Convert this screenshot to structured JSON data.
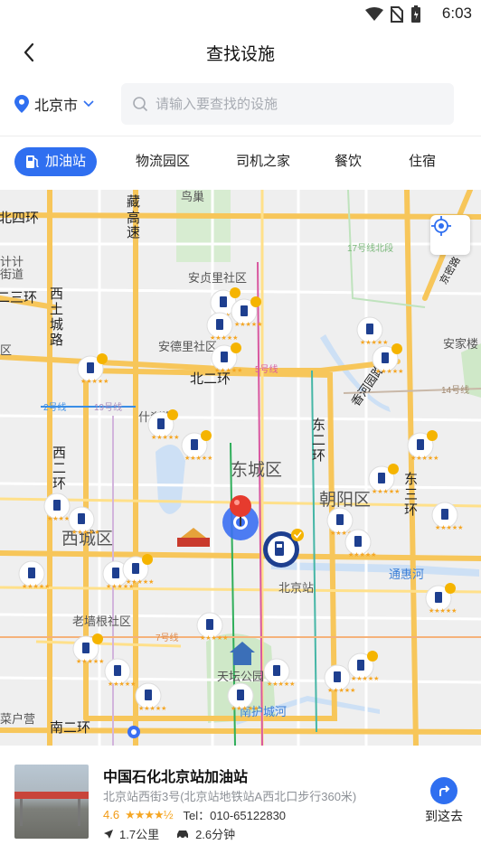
{
  "status_bar": {
    "time": "6:03"
  },
  "header": {
    "title": "查找设施",
    "back_icon": "chevron-left-icon"
  },
  "search": {
    "city": "北京市",
    "placeholder": "请输入要查找的设施"
  },
  "tabs": [
    {
      "label": "加油站",
      "active": true
    },
    {
      "label": "物流园区",
      "active": false
    },
    {
      "label": "司机之家",
      "active": false
    },
    {
      "label": "餐饮",
      "active": false
    },
    {
      "label": "住宿",
      "active": false
    }
  ],
  "map": {
    "labels": {
      "niaochao": "鸟巢",
      "zangda": "藏",
      "zangda2": "高",
      "zangda3": "速",
      "beisihuan": "北四环",
      "beisihuan2": "B四环",
      "shiji": "计计",
      "jiedao": "道",
      "jiedao2": "街道",
      "xisanhuan": "二三环",
      "xisanhuan2": "区",
      "xizhimen": "西",
      "anzhen": "安贞里社区",
      "andeli": "安德里社区",
      "beierhuan": "北二环",
      "line5": "5号线",
      "line2": "2号线",
      "line19": "19号线",
      "line17": "17号线北段",
      "line14": "14号线",
      "line7": "7号线",
      "jingmi": "京密路",
      "xiangheyuan": "香河园路",
      "anjiachu": "安家楼",
      "shichahai": "什刹海",
      "dongcheng": "东城区",
      "chaoyang": "朝阳区",
      "xicheng": "西城区",
      "dongerhuan": "东二环",
      "dongsanhuan": "东三环",
      "xierhuan": "西二环",
      "laoqiang": "老墙根社区",
      "tongbai": "通惠河",
      "beijingzhan": "北京站",
      "tiantan": "天坛公园",
      "nanhucheng": "南护城河",
      "caihuying": "菜户营",
      "nanerhuan": "南二环",
      "xitucheng": "西土城路"
    },
    "station_icon": "gas-station-icon",
    "locate_icon": "locate-icon",
    "pin_icon": "map-pin-icon"
  },
  "station_card": {
    "name": "中国石化北京站加油站",
    "address": "北京站西街3号(北京站地铁站A西北口步行360米)",
    "score": "4.6",
    "stars": "★★★★½",
    "tel": "Tel：010-65122830",
    "distance": "1.7公里",
    "duration": "2.6分钟",
    "go_label": "到这去"
  },
  "colors": {
    "accent": "#2f6ff0",
    "road": "#f7c65a",
    "star": "#f5a623"
  }
}
